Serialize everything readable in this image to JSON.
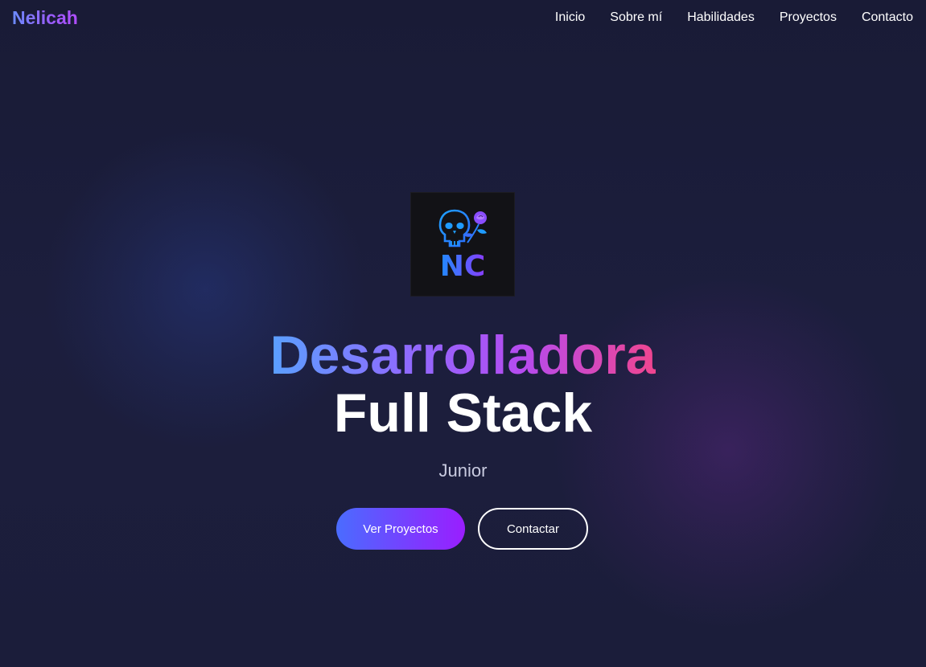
{
  "nav": {
    "brand": "Nelicah",
    "items": [
      {
        "label": "Inicio"
      },
      {
        "label": "Sobre mí"
      },
      {
        "label": "Habilidades"
      },
      {
        "label": "Proyectos"
      },
      {
        "label": "Contacto"
      }
    ]
  },
  "hero": {
    "logo": {
      "icon_names": [
        "skull-icon",
        "rose-icon"
      ],
      "monogram": "NC"
    },
    "title_line1": "Desarrolladora",
    "title_line2": "Full Stack",
    "subtitle": "Junior",
    "buttons": {
      "primary_label": "Ver Proyectos",
      "secondary_label": "Contactar"
    }
  },
  "colors": {
    "background": "#1b1d3a",
    "brand_gradient_start": "#6b8cff",
    "brand_gradient_end": "#b04dff",
    "title_gradient": [
      "#5aa0ff",
      "#8e6bff",
      "#b54bf0",
      "#f0458f"
    ],
    "primary_button_gradient": [
      "#4a6cff",
      "#9a1eff"
    ],
    "subtitle": "#c9cbe0"
  }
}
